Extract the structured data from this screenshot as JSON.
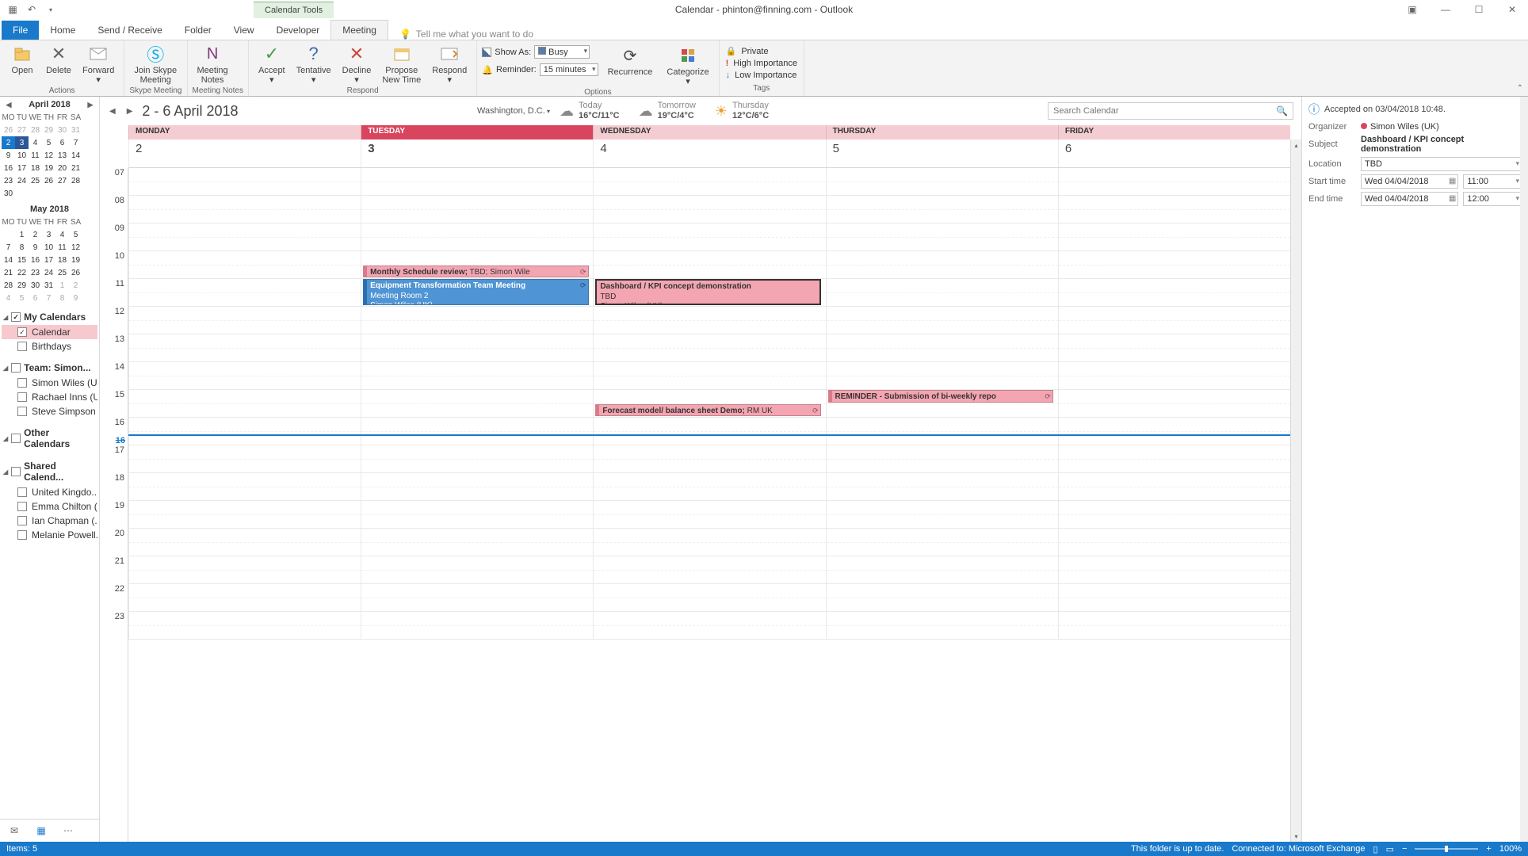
{
  "title": "Calendar - phinton@finning.com - Outlook",
  "calendar_tools": "Calendar Tools",
  "quick_access": [
    "▦",
    "↶",
    "▾"
  ],
  "window_buttons": [
    "▣",
    "—",
    "☐",
    "✕"
  ],
  "tabs": {
    "file": "File",
    "list": [
      "Home",
      "Send / Receive",
      "Folder",
      "View",
      "Developer"
    ],
    "active": "Meeting",
    "tellme": "Tell me what you want to do"
  },
  "ribbon": {
    "actions": {
      "label": "Actions",
      "open": "Open",
      "delete": "Delete",
      "forward": "Forward"
    },
    "skype": {
      "label": "Skype Meeting",
      "btn": "Join Skype\nMeeting"
    },
    "notes": {
      "label": "Meeting Notes",
      "btn": "Meeting\nNotes"
    },
    "respond": {
      "label": "Respond",
      "accept": "Accept",
      "tentative": "Tentative",
      "decline": "Decline",
      "propose": "Propose\nNew Time",
      "respond": "Respond"
    },
    "options": {
      "label": "Options",
      "show_as": "Show As:",
      "show_as_val": "Busy",
      "reminder": "Reminder:",
      "reminder_val": "15 minutes",
      "recurrence": "Recurrence",
      "categorize": "Categorize"
    },
    "tags": {
      "label": "Tags",
      "private": "Private",
      "high": "High Importance",
      "low": "Low Importance"
    }
  },
  "minicals": [
    {
      "title": "April 2018",
      "show_nav": true,
      "hdr": [
        "MO",
        "TU",
        "WE",
        "TH",
        "FR",
        "SA"
      ],
      "weeks": [
        {
          "cells": [
            26,
            27,
            28,
            29,
            30,
            31
          ],
          "prev": true
        },
        {
          "cells": [
            2,
            3,
            4,
            5,
            6,
            7
          ],
          "today_idx": 0,
          "sel_idx": 1
        },
        {
          "cells": [
            9,
            10,
            11,
            12,
            13,
            14
          ]
        },
        {
          "cells": [
            16,
            17,
            18,
            19,
            20,
            21
          ]
        },
        {
          "cells": [
            23,
            24,
            25,
            26,
            27,
            28
          ]
        },
        {
          "cells": [
            30,
            "",
            "",
            "",
            "",
            ""
          ]
        }
      ]
    },
    {
      "title": "May 2018",
      "show_nav": false,
      "hdr": [
        "MO",
        "TU",
        "WE",
        "TH",
        "FR",
        "SA"
      ],
      "weeks": [
        {
          "cells": [
            "",
            1,
            2,
            3,
            4,
            5
          ]
        },
        {
          "cells": [
            7,
            8,
            9,
            10,
            11,
            12
          ]
        },
        {
          "cells": [
            14,
            15,
            16,
            17,
            18,
            19
          ]
        },
        {
          "cells": [
            21,
            22,
            23,
            24,
            25,
            26
          ]
        },
        {
          "cells": [
            28,
            29,
            30,
            31,
            1,
            2
          ],
          "nextfrom": 4
        },
        {
          "cells": [
            4,
            5,
            6,
            7,
            8,
            9
          ],
          "prev": true
        }
      ]
    }
  ],
  "cal_groups": [
    {
      "title": "My Calendars",
      "chk": true,
      "items": [
        {
          "name": "Calendar",
          "checked": true,
          "sel": true
        },
        {
          "name": "Birthdays",
          "checked": false
        }
      ]
    },
    {
      "title": "Team: Simon...",
      "chk": false,
      "items": [
        {
          "name": "Simon Wiles (UK)",
          "checked": false
        },
        {
          "name": "Rachael Inns (UK)",
          "checked": false
        },
        {
          "name": "Steve Simpson (...",
          "checked": false
        }
      ]
    },
    {
      "title": "Other Calendars",
      "chk": false,
      "items": []
    },
    {
      "title": "Shared Calend...",
      "chk": false,
      "items": [
        {
          "name": "United Kingdo...",
          "checked": false
        },
        {
          "name": "Emma Chilton (...",
          "checked": false
        },
        {
          "name": "Ian Chapman (...",
          "checked": false
        },
        {
          "name": "Melanie Powell...",
          "checked": false
        }
      ]
    }
  ],
  "calview": {
    "range": "2 - 6 April 2018",
    "location": "Washington, D.C.",
    "weather": [
      {
        "day": "Today",
        "temps": "16°C/11°C",
        "icon": "☁"
      },
      {
        "day": "Tomorrow",
        "temps": "19°C/4°C",
        "icon": "☁"
      },
      {
        "day": "Thursday",
        "temps": "12°C/6°C",
        "icon": "☀"
      }
    ],
    "search_ph": "Search Calendar",
    "days": [
      {
        "name": "MONDAY",
        "num": "2"
      },
      {
        "name": "TUESDAY",
        "num": "3",
        "today": true
      },
      {
        "name": "WEDNESDAY",
        "num": "4"
      },
      {
        "name": "THURSDAY",
        "num": "5"
      },
      {
        "name": "FRIDAY",
        "num": "6"
      }
    ],
    "hours": [
      "07",
      "08",
      "09",
      "10",
      "11",
      "12",
      "13",
      "14",
      "15",
      "16",
      "17",
      "18",
      "19",
      "20",
      "21",
      "22",
      "23"
    ],
    "now": "16",
    "now_offset_pct": 56.5
  },
  "appts": [
    {
      "day": 1,
      "start_idx": 3.5,
      "dur": 0.5,
      "cls": "pink",
      "title": "Monthly Schedule review;",
      "extra": " TBD; Simon Wile",
      "rec": true
    },
    {
      "day": 1,
      "start_idx": 4,
      "dur": 1,
      "cls": "blue",
      "title": "Equipment Transformation Team Meeting",
      "line2": "Meeting Room 2",
      "line3": "Simon Wiles (UK)",
      "rec": true
    },
    {
      "day": 2,
      "start_idx": 4,
      "dur": 1,
      "cls": "pink",
      "title": "Dashboard / KPI concept demonstration",
      "line2": "TBD",
      "line3": "Simon Wiles (UK)",
      "selected": true
    },
    {
      "day": 2,
      "start_idx": 8.5,
      "dur": 0.5,
      "cls": "pink",
      "title": "Forecast model/ balance sheet Demo;",
      "extra": " RM UK",
      "rec": true
    },
    {
      "day": 3,
      "start_idx": 8,
      "dur": 0.5,
      "cls": "pink",
      "title": "REMINDER - Submission of bi-weekly repo",
      "rec": true
    }
  ],
  "reading": {
    "status": "Accepted on 03/04/2018 10:48.",
    "organizer_lbl": "Organizer",
    "organizer": "Simon Wiles (UK)",
    "subject_lbl": "Subject",
    "subject": "Dashboard / KPI concept demonstration",
    "location_lbl": "Location",
    "location": "TBD",
    "start_lbl": "Start time",
    "start_date": "Wed 04/04/2018",
    "start_time": "11:00",
    "end_lbl": "End time",
    "end_date": "Wed 04/04/2018",
    "end_time": "12:00"
  },
  "status": {
    "items": "Items: 5",
    "folder": "This folder is up to date.",
    "connected": "Connected to: Microsoft Exchange",
    "zoom": "100%"
  }
}
